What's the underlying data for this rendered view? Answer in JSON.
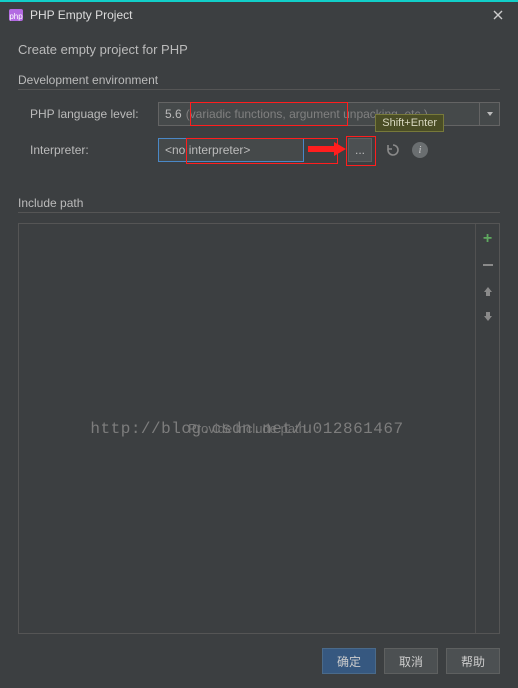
{
  "titlebar": {
    "title": "PHP Empty Project"
  },
  "instruction": "Create empty project for PHP",
  "dev_env": {
    "group_title": "Development environment",
    "php_level_label": "PHP language level:",
    "php_level_value": "5.6",
    "php_level_hint": "(variadic functions, argument unpacking, etc.)",
    "interpreter_label": "Interpreter:",
    "interpreter_value": "<no interpreter>",
    "ellipsis": "...",
    "tooltip": "Shift+Enter",
    "info_char": "i"
  },
  "include": {
    "title": "Include path",
    "placeholder": "Provide include path"
  },
  "watermark": "http://blog.csdn.net/u012861467",
  "buttons": {
    "ok": "确定",
    "cancel": "取消",
    "help": "帮助"
  }
}
